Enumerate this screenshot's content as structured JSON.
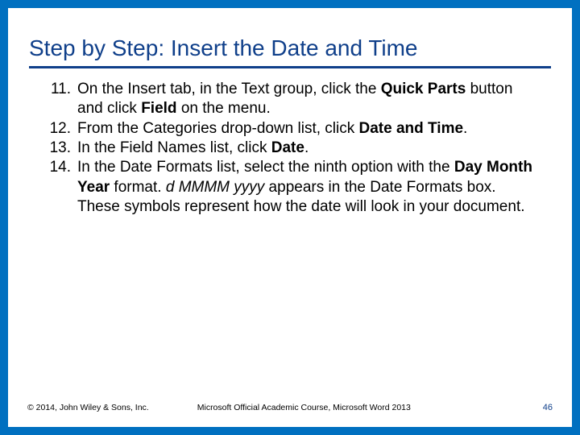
{
  "title": "Step by Step: Insert the Date and Time",
  "steps": [
    {
      "num": "11.",
      "segments": [
        {
          "t": "On the Insert tab, in the Text group, click the "
        },
        {
          "t": "Quick Parts",
          "b": true
        },
        {
          "t": " button and click "
        },
        {
          "t": "Field",
          "b": true
        },
        {
          "t": " on the menu."
        }
      ]
    },
    {
      "num": "12.",
      "segments": [
        {
          "t": "From the Categories drop-down list, click "
        },
        {
          "t": "Date and Time",
          "b": true
        },
        {
          "t": "."
        }
      ]
    },
    {
      "num": "13.",
      "segments": [
        {
          "t": "In the Field Names list, click "
        },
        {
          "t": "Date",
          "b": true
        },
        {
          "t": "."
        }
      ]
    },
    {
      "num": "14.",
      "segments": [
        {
          "t": "In the Date Formats list, select the ninth option with the "
        },
        {
          "t": "Day Month Year",
          "b": true
        },
        {
          "t": " format. "
        },
        {
          "t": "d MMMM yyyy",
          "i": true
        },
        {
          "t": " appears in the Date Formats box. These symbols represent how the date will look in your document."
        }
      ]
    }
  ],
  "footer": {
    "copyright": "© 2014, John Wiley & Sons, Inc.",
    "course": "Microsoft Official Academic Course, Microsoft Word 2013",
    "pagenum": "46"
  }
}
